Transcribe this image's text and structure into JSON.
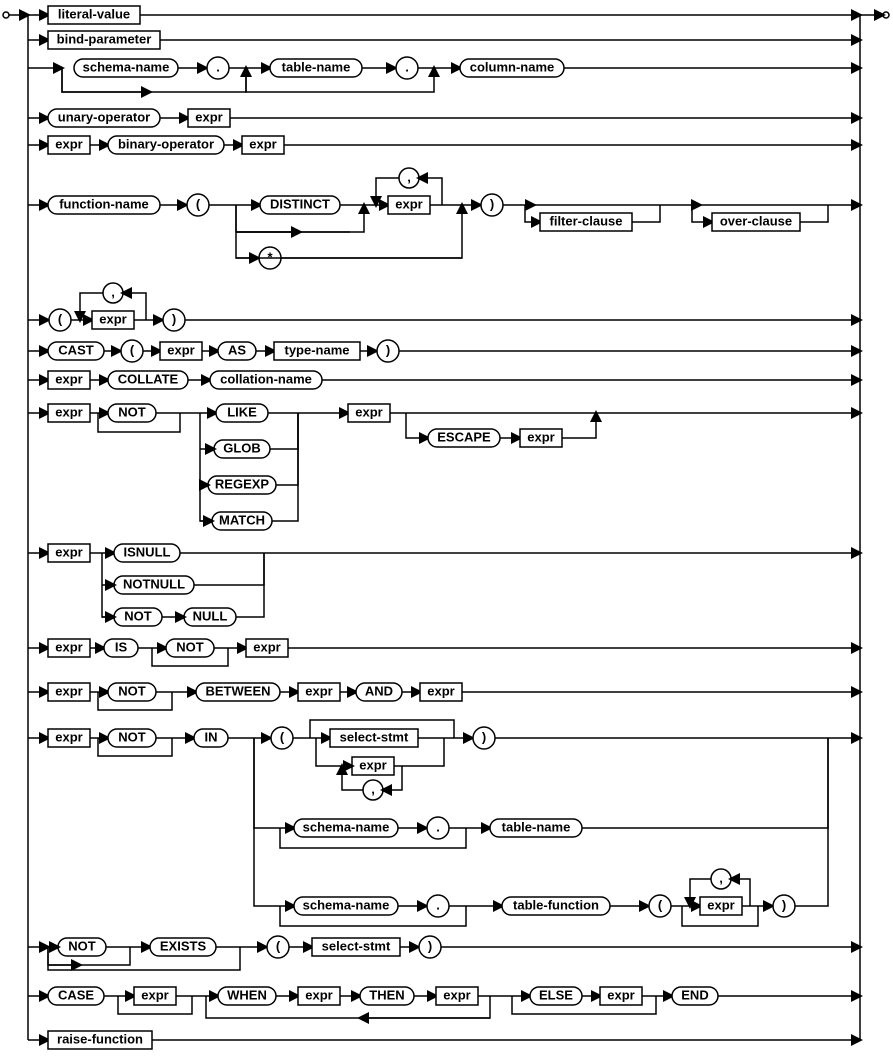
{
  "labels": {
    "literal_value": "literal-value",
    "bind_parameter": "bind-parameter",
    "schema_name": "schema-name",
    "dot": ".",
    "table_name": "table-name",
    "column_name": "column-name",
    "unary_operator": "unary-operator",
    "expr": "expr",
    "binary_operator": "binary-operator",
    "function_name": "function-name",
    "lparen": "(",
    "rparen": ")",
    "distinct": "DISTINCT",
    "comma": ",",
    "star": "*",
    "filter_clause": "filter-clause",
    "over_clause": "over-clause",
    "cast": "CAST",
    "as": "AS",
    "type_name": "type-name",
    "collate": "COLLATE",
    "collation_name": "collation-name",
    "not": "NOT",
    "like": "LIKE",
    "glob": "GLOB",
    "regexp": "REGEXP",
    "match": "MATCH",
    "escape": "ESCAPE",
    "isnull": "ISNULL",
    "notnull": "NOTNULL",
    "null": "NULL",
    "is": "IS",
    "between": "BETWEEN",
    "and": "AND",
    "in": "IN",
    "select_stmt": "select-stmt",
    "table_function": "table-function",
    "exists": "EXISTS",
    "case": "CASE",
    "when": "WHEN",
    "then": "THEN",
    "else": "ELSE",
    "end": "END",
    "raise_function": "raise-function"
  }
}
